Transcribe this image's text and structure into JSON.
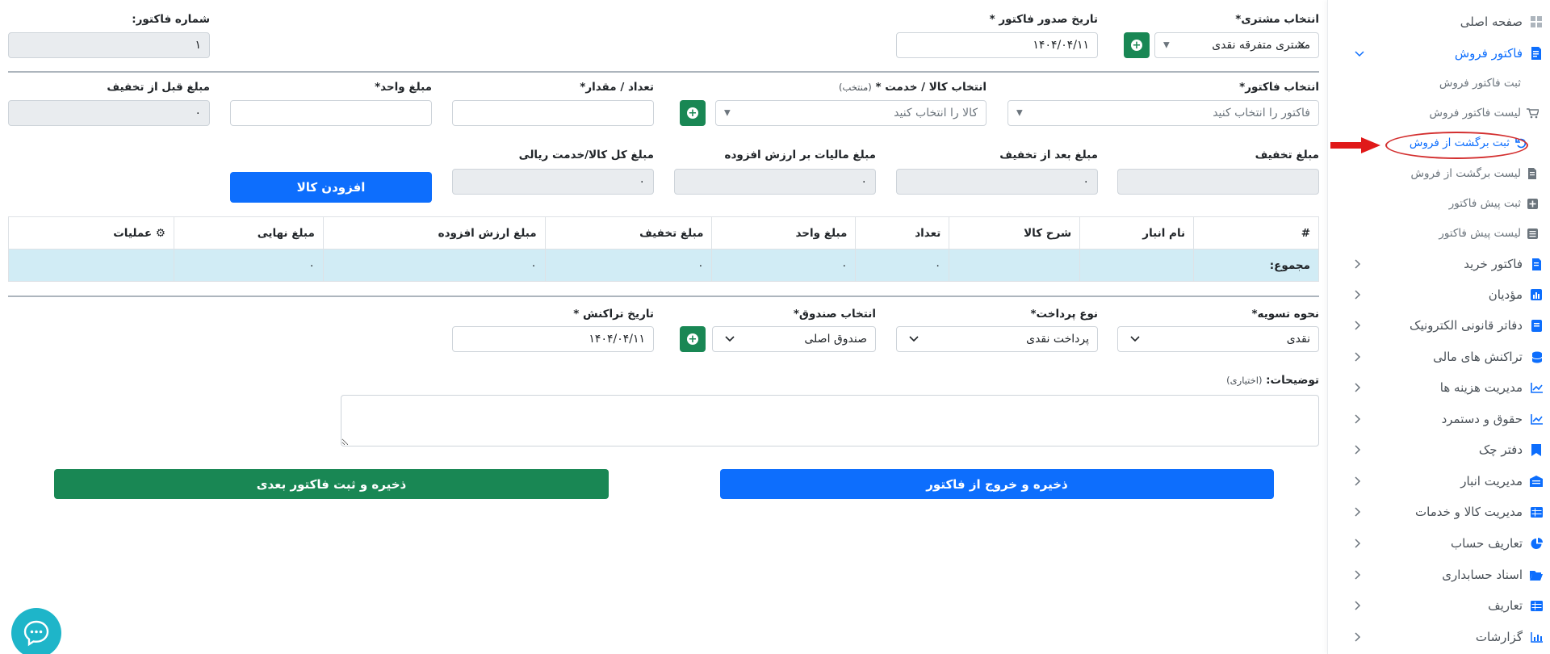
{
  "sidebar": {
    "home": "صفحه اصلی",
    "sales": "فاکتور فروش",
    "sales_sub": [
      "ثبت فاکتور فروش",
      "لیست فاکتور فروش",
      "ثبت برگشت از فروش",
      "لیست برگشت از فروش",
      "ثبت پیش فاکتور",
      "لیست پیش فاکتور"
    ],
    "items": [
      "فاکتور خرید",
      "مؤدیان",
      "دفاتر قانونی الکترونیک",
      "تراکنش های مالی",
      "مدیریت هزینه ها",
      "حقوق و دستمرد",
      "دفتر چک",
      "مدیریت انبار",
      "مدیریت کالا و خدمات",
      "تعاریف حساب",
      "اسناد حسابداری",
      "تعاریف",
      "گزارشات"
    ]
  },
  "header": {
    "customer_label": "انتخاب مشتری*",
    "customer_value": "مشتری متفرقه نقدی",
    "customer_clear": "×",
    "date_label": "تاریخ صدور فاکتور *",
    "date_value": "۱۴۰۴/۰۴/۱۱",
    "number_label": "شماره فاکتور:",
    "number_value": "۱"
  },
  "items_row": {
    "invoice_label": "انتخاب فاکتور*",
    "invoice_placeholder": "فاکتور را انتخاب کنید",
    "product_label": "انتخاب کالا / خدمت *",
    "product_label_note": "(منتخب)",
    "product_placeholder": "کالا را انتخاب کنید",
    "qty_label": "تعداد / مقدار*",
    "qty_value": "",
    "unit_price_label": "مبلغ واحد*",
    "unit_price_value": "",
    "before_discount_label": "مبلغ قبل از تخفیف",
    "before_discount_value": "۰"
  },
  "amounts_row": {
    "discount_label": "مبلغ تخفیف",
    "discount_value": "",
    "after_discount_label": "مبلغ بعد از تخفیف",
    "after_discount_value": "۰",
    "vat_label": "مبلغ مالیات بر ارزش افزوده",
    "vat_value": "۰",
    "total_label": "مبلغ کل کالا/خدمت ریالی",
    "total_value": "۰",
    "add_button": "افزودن کالا"
  },
  "table": {
    "headers": [
      "#",
      "نام انبار",
      "شرح کالا",
      "تعداد",
      "مبلغ واحد",
      "مبلغ تخفیف",
      "مبلغ ارزش افزوده",
      "مبلغ نهایی",
      "عملیات"
    ],
    "totals_label": "مجموع:",
    "totals": {
      "qty": "۰",
      "unit": "۰",
      "discount": "۰",
      "vat": "۰",
      "final": "۰"
    }
  },
  "payment": {
    "settle_label": "نحوه تسویه*",
    "settle_value": "نقدی",
    "pay_type_label": "نوع پرداخت*",
    "pay_type_value": "پرداخت نقدی",
    "cashbox_label": "انتخاب صندوق*",
    "cashbox_value": "صندوق اصلی",
    "txn_date_label": "تاریخ تراکنش *",
    "txn_date_value": "۱۴۰۴/۰۴/۱۱"
  },
  "notes": {
    "label": "توضیحات:",
    "label_note": "(اختیاری)",
    "value": ""
  },
  "actions": {
    "save_exit": "ذخیره و خروج از فاکتور",
    "save_next": "ذخیره و ثبت فاکتور بعدی"
  },
  "colors": {
    "primary": "#0d6efd",
    "success": "#198754",
    "highlight": "#d32f2f",
    "table_total_bg": "#d1ecf5"
  }
}
